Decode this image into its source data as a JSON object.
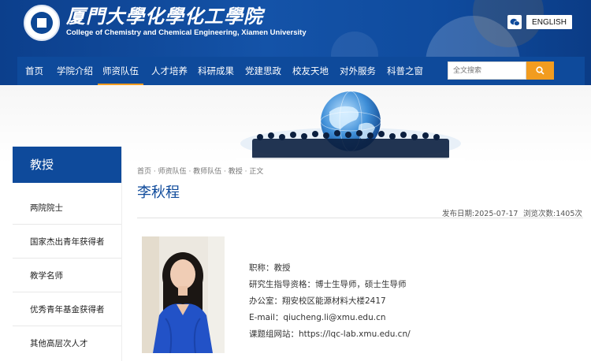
{
  "brand": {
    "name_cn": "厦門大學化學化工學院",
    "name_en": "College of Chemistry and Chemical Engineering, Xiamen University"
  },
  "header": {
    "language_label": "ENGLISH"
  },
  "nav": {
    "items": [
      "首页",
      "学院介绍",
      "师资队伍",
      "人才培养",
      "科研成果",
      "党建思政",
      "校友天地",
      "对外服务",
      "科普之窗"
    ],
    "active_index": 2
  },
  "search": {
    "placeholder": "全文搜索"
  },
  "sidebar": {
    "heading": "教授",
    "items": [
      "两院院士",
      "国家杰出青年获得者",
      "教学名师",
      "优秀青年基金获得者",
      "其他高层次人才"
    ]
  },
  "article": {
    "breadcrumb": "首页 · 师资队伍 · 教师队伍 · 教授 · 正文",
    "title": "李秋程",
    "publish_date": "发布日期:2025-07-17",
    "views": "浏览次数:1405次",
    "info": [
      {
        "label": "职称：",
        "value": "教授"
      },
      {
        "label": "研究生指导资格：",
        "value": "博士生导师，硕士生导师"
      },
      {
        "label": "办公室：",
        "value": "翔安校区能源材料大楼2417"
      },
      {
        "label": "E-mail：",
        "value": "qiucheng.li@xmu.edu.cn"
      },
      {
        "label": "课题组网站：",
        "value": "https://lqc-lab.xmu.edu.cn/"
      }
    ]
  },
  "colors": {
    "primary": "#0e4a9b",
    "accent": "#f29c1f"
  },
  "icons": {
    "wechat": "wechat-icon",
    "search": "search-icon",
    "logo": "university-seal-icon"
  }
}
